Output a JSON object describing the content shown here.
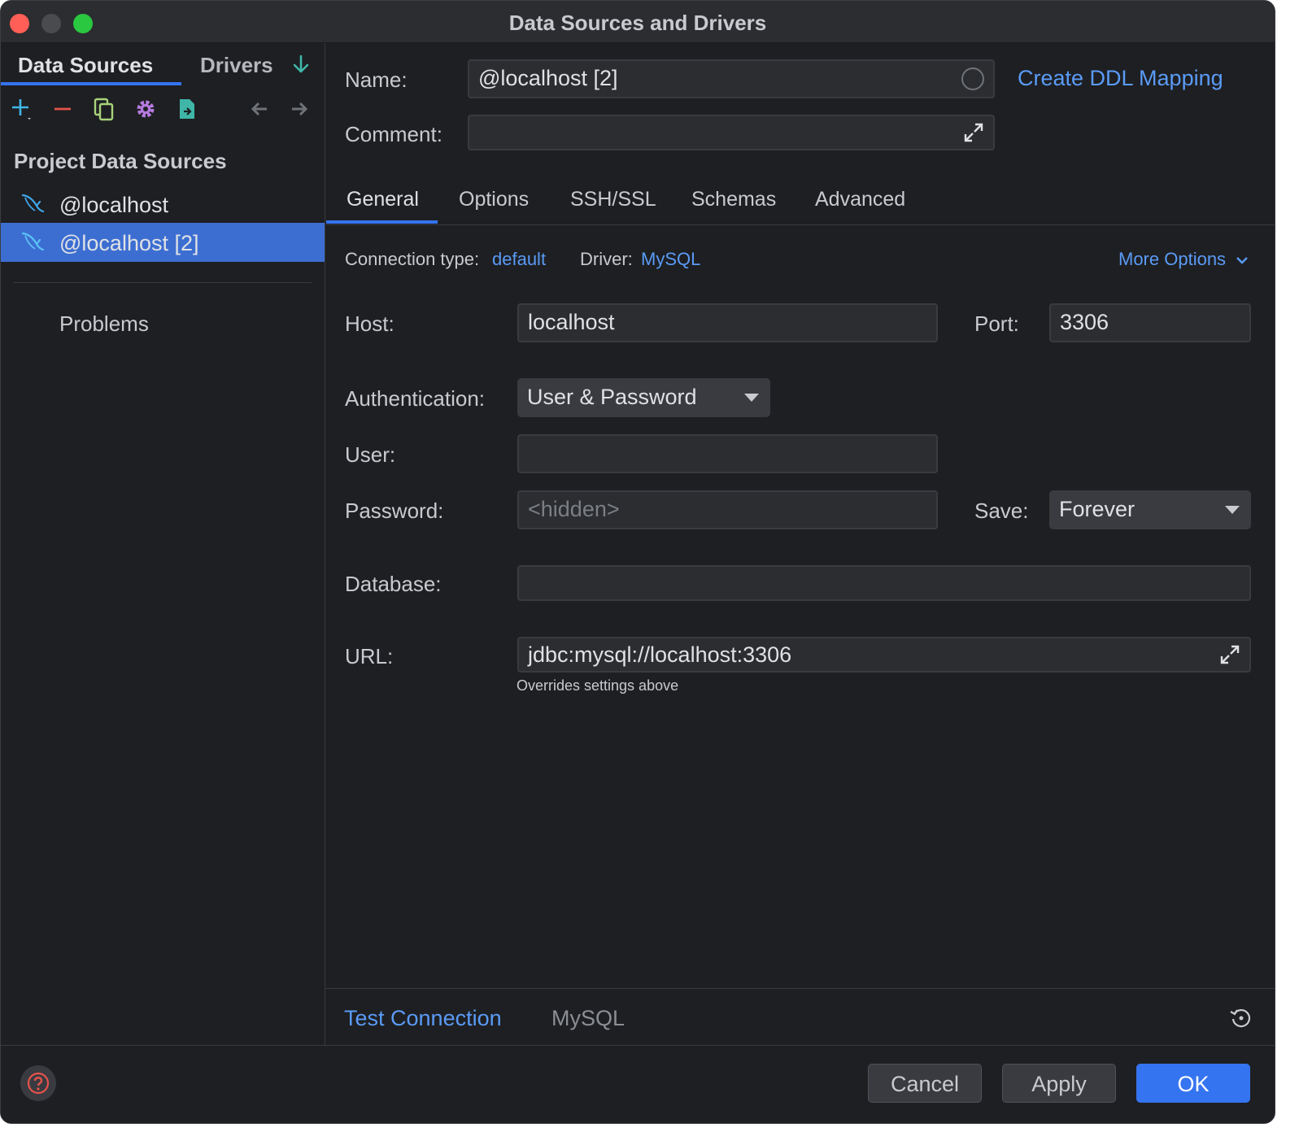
{
  "window": {
    "title": "Data Sources and Drivers"
  },
  "left": {
    "tabs": [
      "Data Sources",
      "Drivers"
    ],
    "section_title": "Project Data Sources",
    "items": [
      "@localhost",
      "@localhost [2]"
    ],
    "problems": "Problems"
  },
  "form": {
    "name_label": "Name:",
    "name_value": "@localhost [2]",
    "comment_label": "Comment:",
    "comment_value": "",
    "ddl_link": "Create DDL Mapping",
    "tabs": [
      "General",
      "Options",
      "SSH/SSL",
      "Schemas",
      "Advanced"
    ],
    "connection_type_label": "Connection type:",
    "connection_type_value": "default",
    "driver_label": "Driver:",
    "driver_value": "MySQL",
    "more_options": "More Options",
    "host_label": "Host:",
    "host_value": "localhost",
    "port_label": "Port:",
    "port_value": "3306",
    "auth_label": "Authentication:",
    "auth_value": "User & Password",
    "user_label": "User:",
    "user_value": "",
    "password_label": "Password:",
    "password_placeholder": "<hidden>",
    "save_label": "Save:",
    "save_value": "Forever",
    "database_label": "Database:",
    "database_value": "",
    "url_label": "URL:",
    "url_value": "jdbc:mysql://localhost:3306",
    "url_hint": "Overrides settings above"
  },
  "bottom_bar": {
    "test_connection": "Test Connection",
    "driver_name": "MySQL"
  },
  "footer": {
    "cancel": "Cancel",
    "apply": "Apply",
    "ok": "OK"
  },
  "colors": {
    "accent": "#3574f0",
    "link": "#5a9bf6",
    "selection": "#3c6ed2",
    "background": "#1e1f22"
  }
}
